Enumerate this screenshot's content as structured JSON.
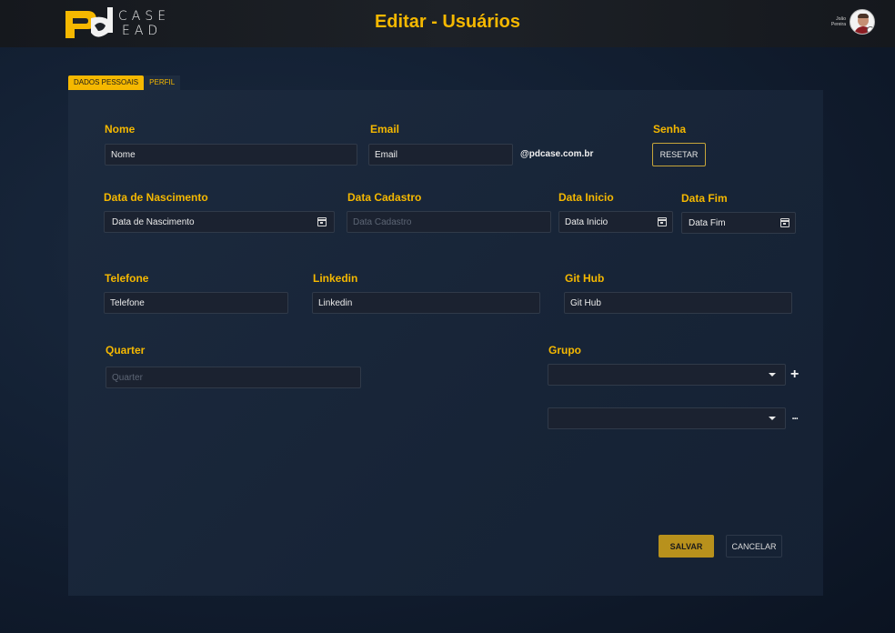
{
  "header": {
    "logo_line1": "CASE",
    "logo_line2": "EAD",
    "title": "Editar - Usuários",
    "user_first": "João",
    "user_last": "Pereira"
  },
  "tabs": [
    {
      "label": "DADOS PESSOAIS",
      "active": true
    },
    {
      "label": "PERFIL",
      "active": false
    }
  ],
  "form": {
    "nome": {
      "label": "Nome",
      "placeholder": "Nome"
    },
    "email": {
      "label": "Email",
      "placeholder": "Email",
      "suffix": "@pdcase.com.br"
    },
    "senha": {
      "label": "Senha",
      "button": "RESETAR"
    },
    "data_nascimento": {
      "label": "Data de Nascimento",
      "placeholder": "Data de Nascimento"
    },
    "data_cadastro": {
      "label": "Data Cadastro",
      "placeholder": "Data Cadastro"
    },
    "data_inicio": {
      "label": "Data Inicio",
      "placeholder": "Data Inicio"
    },
    "data_fim": {
      "label": "Data Fim",
      "placeholder": "Data Fim"
    },
    "telefone": {
      "label": "Telefone",
      "placeholder": "Telefone"
    },
    "linkedin": {
      "label": "Linkedin",
      "placeholder": "Linkedin"
    },
    "github": {
      "label": "Git Hub",
      "placeholder": "Git Hub"
    },
    "quarter": {
      "label": "Quarter",
      "placeholder": "Quarter"
    },
    "grupo": {
      "label": "Grupo",
      "add_symbol": "+",
      "more_symbol": "•••"
    }
  },
  "actions": {
    "save": "SALVAR",
    "cancel": "CANCELAR"
  },
  "colors": {
    "accent": "#f5b800",
    "background": "#132033",
    "field_bg": "#1b2230"
  },
  "icons": [
    "calendar-icon",
    "chevron-down-icon",
    "plus-icon",
    "more-icon"
  ]
}
